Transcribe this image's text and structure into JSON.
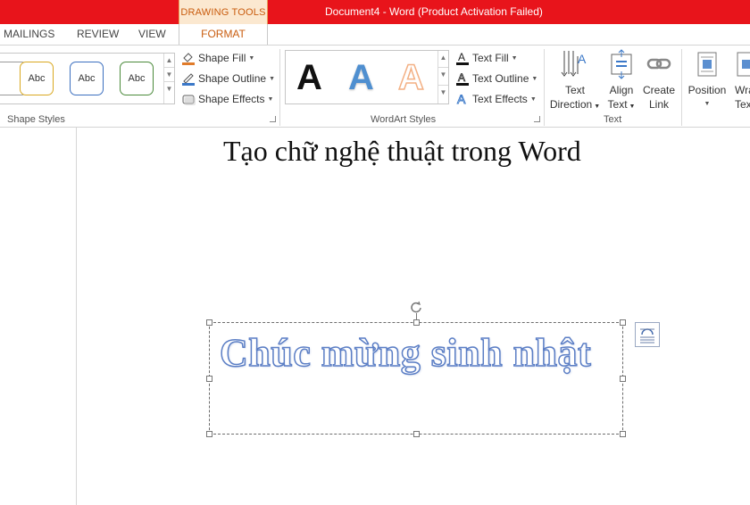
{
  "titlebar": {
    "context_label": "DRAWING TOOLS",
    "title": "Document4 -  Word (Product Activation Failed)"
  },
  "tabs": {
    "mailings": "MAILINGS",
    "review": "REVIEW",
    "view": "VIEW",
    "format": "FORMAT"
  },
  "shape_styles": {
    "group_label": "Shape Styles",
    "gallery": [
      {
        "label": "Abc",
        "border": "#d9a820"
      },
      {
        "label": "Abc",
        "border": "#3b6fbf"
      },
      {
        "label": "Abc",
        "border": "#4a8a3a"
      }
    ],
    "shape_fill": "Shape Fill",
    "shape_outline": "Shape Outline",
    "shape_effects": "Shape Effects"
  },
  "wordart_styles": {
    "group_label": "WordArt Styles",
    "gallery": [
      {
        "label": "A",
        "color": "#111111"
      },
      {
        "label": "A",
        "color": "#4f8fd0"
      },
      {
        "label": "A",
        "color": "#f3b084"
      }
    ],
    "text_fill": "Text Fill",
    "text_outline": "Text Outline",
    "text_effects": "Text Effects"
  },
  "text_group": {
    "group_label": "Text",
    "text_direction": [
      "Text",
      "Direction"
    ],
    "align_text": [
      "Align",
      "Text"
    ],
    "create_link": [
      "Create",
      "Link"
    ]
  },
  "arrange": {
    "position": "Position",
    "wrap_top": "Wra",
    "wrap_bottom": "Tex"
  },
  "document": {
    "heading": "Tạo chữ nghệ thuật trong Word",
    "wordart_text": "Chúc mừng sinh nhật"
  },
  "colors": {
    "titlebar": "#e8141b",
    "accent": "#c95c0e"
  }
}
